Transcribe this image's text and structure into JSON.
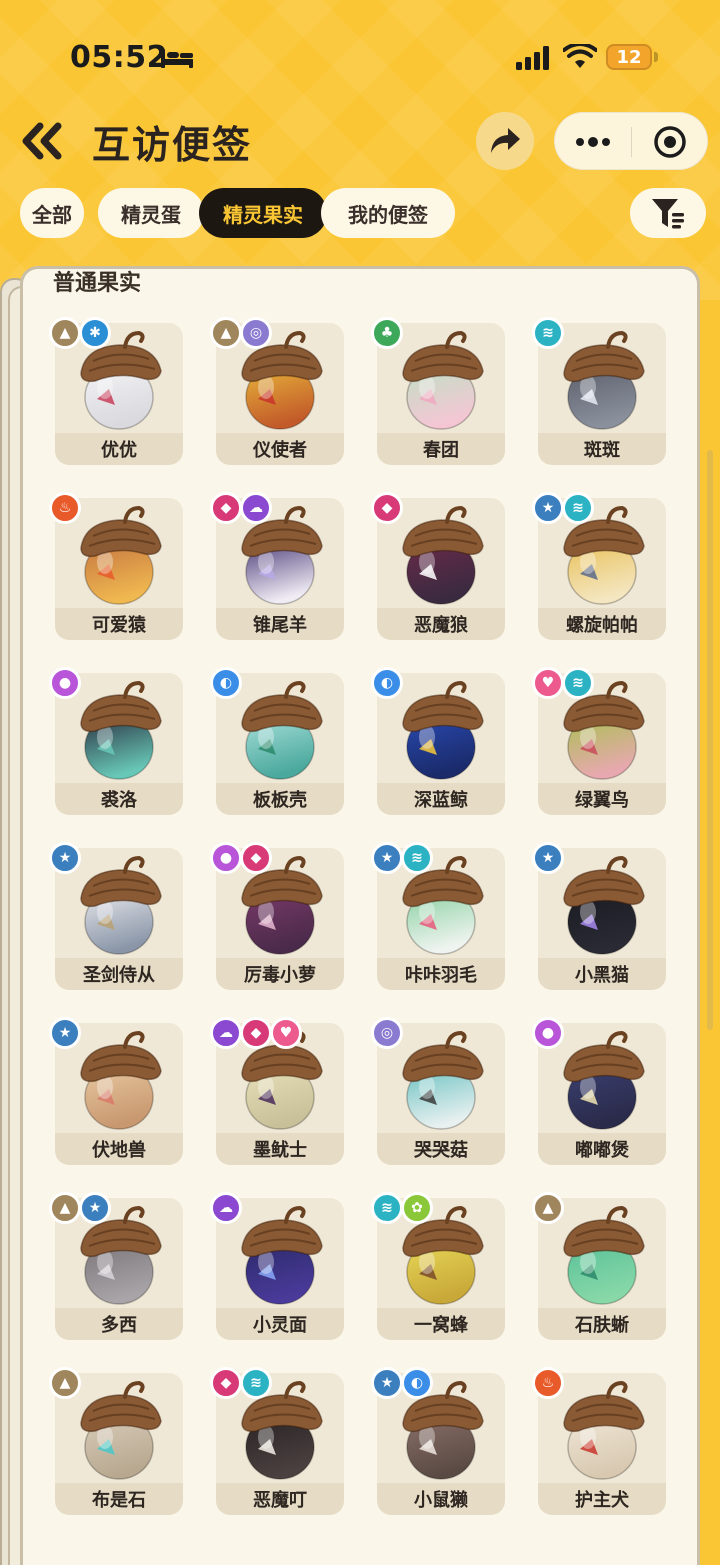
{
  "status": {
    "time": "05:52",
    "battery": "12"
  },
  "header": {
    "title": "互访便签"
  },
  "tabs": [
    {
      "label": "全部",
      "active": false
    },
    {
      "label": "精灵蛋",
      "active": false
    },
    {
      "label": "精灵果实",
      "active": true
    },
    {
      "label": "我的便签",
      "active": false
    }
  ],
  "section": {
    "title": "普通果实"
  },
  "colors": {
    "background": "#fbc634",
    "active_tab": "#1d1712",
    "acorn_cap": "#8a5a34",
    "attr_ground": "#a0865c",
    "attr_mechanical": "#2a8fd4",
    "attr_illusion": "#8a7ad0",
    "attr_grass": "#3ea85a",
    "attr_wing": "#2bb3c4",
    "attr_fire": "#e85a2a",
    "attr_evil": "#d83a78",
    "attr_ghost": "#8b48d0",
    "attr_poison": "#b855d8",
    "attr_water": "#3a8ee8",
    "attr_cute": "#ec5a8e",
    "attr_normal": "#3b7fbf",
    "attr_bug": "#8ac83a"
  },
  "items": [
    {
      "name": "优优",
      "attrs": [
        "ground-icon",
        "mechanical-icon"
      ],
      "body": [
        "#f4f4f6",
        "#d9d9de"
      ],
      "accent": "#c8405a"
    },
    {
      "name": "仪使者",
      "attrs": [
        "ground-icon",
        "illusion-icon"
      ],
      "body": [
        "#e8b63a",
        "#c25a2a"
      ],
      "accent": "#c8342a"
    },
    {
      "name": "春团",
      "attrs": [
        "grass-icon"
      ],
      "body": [
        "#bfe0c4",
        "#f4c6d4"
      ],
      "accent": "#f0a8c0"
    },
    {
      "name": "斑斑",
      "attrs": [
        "wing-icon"
      ],
      "body": [
        "#5a5e6a",
        "#8a909c"
      ],
      "accent": "#e8ecf4"
    },
    {
      "name": "可爱猿",
      "attrs": [
        "fire-icon"
      ],
      "body": [
        "#c47440",
        "#f0b850"
      ],
      "accent": "#e85a2a"
    },
    {
      "name": "锥尾羊",
      "attrs": [
        "evil-icon",
        "ghost-icon"
      ],
      "body": [
        "#4a3a78",
        "#f0ecf4"
      ],
      "accent": "#b8a8e8"
    },
    {
      "name": "恶魔狼",
      "attrs": [
        "evil-icon"
      ],
      "body": [
        "#6a2a4a",
        "#3a2a40"
      ],
      "accent": "#ffffff"
    },
    {
      "name": "螺旋帕帕",
      "attrs": [
        "normal-icon",
        "wing-icon"
      ],
      "body": [
        "#e8c058",
        "#f4e6c0"
      ],
      "accent": "#5a6a8a"
    },
    {
      "name": "裘洛",
      "attrs": [
        "poison-icon"
      ],
      "body": [
        "#2a3040",
        "#68c8b8"
      ],
      "accent": "#68c8b8"
    },
    {
      "name": "板板壳",
      "attrs": [
        "water-icon"
      ],
      "body": [
        "#a8e0dc",
        "#4aa89c"
      ],
      "accent": "#2a8a6a"
    },
    {
      "name": "深蓝鲸",
      "attrs": [
        "water-icon"
      ],
      "body": [
        "#2a4ab0",
        "#1a2a6a"
      ],
      "accent": "#f4c838"
    },
    {
      "name": "绿翼鸟",
      "attrs": [
        "cute-icon",
        "wing-icon"
      ],
      "body": [
        "#a8c050",
        "#e8a8b0"
      ],
      "accent": "#c84a5a"
    },
    {
      "name": "圣剑侍从",
      "attrs": [
        "normal-icon"
      ],
      "body": [
        "#e8e8ec",
        "#8a96a8"
      ],
      "accent": "#b8a070"
    },
    {
      "name": "厉毒小萝",
      "attrs": [
        "poison-icon",
        "evil-icon"
      ],
      "body": [
        "#7a3a6a",
        "#4a2a4a"
      ],
      "accent": "#e8b8d0"
    },
    {
      "name": "咔咔羽毛",
      "attrs": [
        "normal-icon",
        "wing-icon"
      ],
      "body": [
        "#88d0a0",
        "#f0f4f0"
      ],
      "accent": "#e8587a"
    },
    {
      "name": "小黑猫",
      "attrs": [
        "normal-icon"
      ],
      "body": [
        "#1a1a22",
        "#2a2a34"
      ],
      "accent": "#a888f0"
    },
    {
      "name": "伏地兽",
      "attrs": [
        "normal-icon"
      ],
      "body": [
        "#e8c8a0",
        "#c89870"
      ],
      "accent": "#d87a6a"
    },
    {
      "name": "墨鱿士",
      "attrs": [
        "ghost-icon",
        "evil-icon",
        "cute-icon"
      ],
      "body": [
        "#e8e0b8",
        "#c8c098"
      ],
      "accent": "#4a2a5a"
    },
    {
      "name": "哭哭菇",
      "attrs": [
        "illusion-icon"
      ],
      "body": [
        "#68c0c0",
        "#e8f0f0"
      ],
      "accent": "#3a3a3a"
    },
    {
      "name": "嘟嘟煲",
      "attrs": [
        "poison-icon"
      ],
      "body": [
        "#3a4070",
        "#2a2a4a"
      ],
      "accent": "#f0e4b0"
    },
    {
      "name": "多西",
      "attrs": [
        "ground-icon",
        "normal-icon"
      ],
      "body": [
        "#7a7478",
        "#a8a4a8"
      ],
      "accent": "#d8d4d8"
    },
    {
      "name": "小灵面",
      "attrs": [
        "ghost-icon"
      ],
      "body": [
        "#2a2a68",
        "#4a3a9a"
      ],
      "accent": "#88a8f8"
    },
    {
      "name": "一窝蜂",
      "attrs": [
        "wing-icon",
        "bug-icon"
      ],
      "body": [
        "#e8d858",
        "#c8a838"
      ],
      "accent": "#7a4a2a"
    },
    {
      "name": "石肤蜥",
      "attrs": [
        "ground-icon"
      ],
      "body": [
        "#58c098",
        "#88d8a8"
      ],
      "accent": "#2a8868"
    },
    {
      "name": "布是石",
      "attrs": [
        "ground-icon"
      ],
      "body": [
        "#d8ccb8",
        "#b8a890"
      ],
      "accent": "#48c8c8"
    },
    {
      "name": "恶魔叮",
      "attrs": [
        "evil-icon",
        "wing-icon"
      ],
      "body": [
        "#2a2424",
        "#4a4040"
      ],
      "accent": "#f4f0e8"
    },
    {
      "name": "小鼠獭",
      "attrs": [
        "normal-icon",
        "water-icon"
      ],
      "body": [
        "#8a7068",
        "#5a4a44"
      ],
      "accent": "#f0e8e0"
    },
    {
      "name": "护主犬",
      "attrs": [
        "fire-icon"
      ],
      "body": [
        "#f0e8d8",
        "#d8c8b0"
      ],
      "accent": "#c8342a"
    }
  ]
}
